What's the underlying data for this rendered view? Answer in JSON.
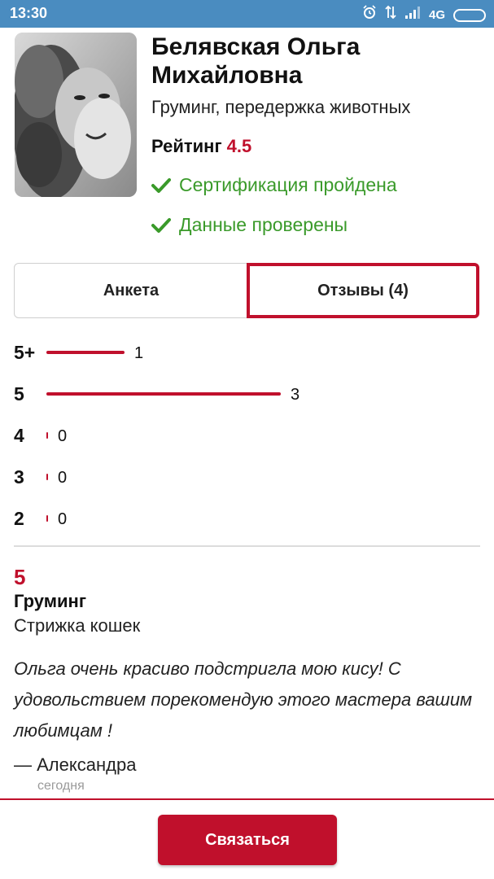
{
  "status_bar": {
    "time": "13:30",
    "network": "4G",
    "icons": [
      "alarm-icon",
      "data-arrows-icon",
      "signal-icon",
      "battery-icon"
    ]
  },
  "profile": {
    "name": "Белявская Ольга Михайловна",
    "specialty": "Груминг, передержка животных",
    "rating_label": "Рейтинг",
    "rating_value": "4.5",
    "certification": "Сертификация пройдена",
    "data_verified": "Данные проверены"
  },
  "tabs": {
    "profile_label": "Анкета",
    "reviews_label": "Отзывы (4)",
    "active": "reviews"
  },
  "rating_distribution": [
    {
      "label": "5+",
      "count": 1
    },
    {
      "label": "5",
      "count": 3
    },
    {
      "label": "4",
      "count": 0
    },
    {
      "label": "3",
      "count": 0
    },
    {
      "label": "2",
      "count": 0
    }
  ],
  "review": {
    "score": "5",
    "category": "Груминг",
    "service": "Стрижка кошек",
    "text": "Ольга очень красиво подстригла мою кису! С удовольствием порекомендую этого мастера вашим любимцам !",
    "author": "— Александра",
    "date": "сегодня"
  },
  "action": {
    "contact_label": "Связаться"
  },
  "colors": {
    "accent": "#c0102c",
    "success": "#3a9a2a",
    "status_bar": "#4a8cc0"
  }
}
